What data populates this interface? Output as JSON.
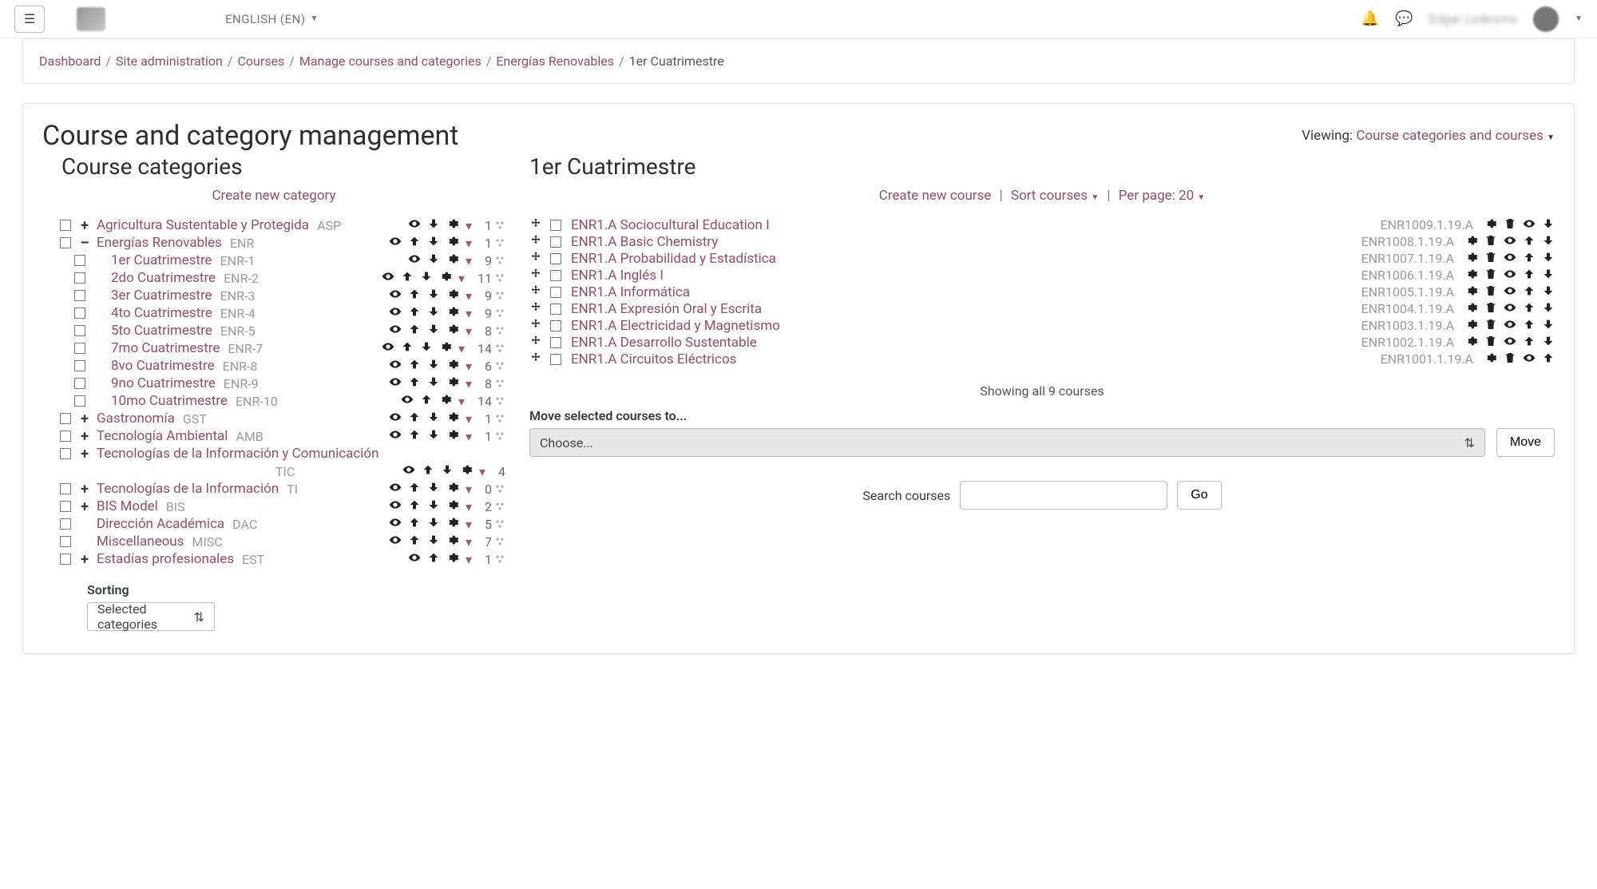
{
  "topbar": {
    "lang": "ENGLISH (EN)",
    "username": "Edgar Ledesma"
  },
  "breadcrumb": [
    "Dashboard",
    "Site administration",
    "Courses",
    "Manage courses and categories",
    "Energías Renovables",
    "1er Cuatrimestre"
  ],
  "page_title": "Course and category management",
  "viewing_label": "Viewing:",
  "viewing_value": "Course categories and courses",
  "left": {
    "title": "Course categories",
    "create": "Create new category",
    "sorting_label": "Sorting",
    "sorting_value": "Selected categories"
  },
  "categories": [
    {
      "indent": 0,
      "toggle": "+",
      "name": "Agricultura Sustentable y Protegida",
      "code": "ASP",
      "count": 1,
      "icons": [
        "eye",
        "down",
        "gear",
        "menu"
      ]
    },
    {
      "indent": 0,
      "toggle": "–",
      "name": "Energías Renovables",
      "code": "ENR",
      "count": 1,
      "icons": [
        "eye",
        "up",
        "down",
        "gear",
        "menu"
      ]
    },
    {
      "indent": 1,
      "toggle": "",
      "name": "1er Cuatrimestre",
      "code": "ENR-1",
      "count": 9,
      "icons": [
        "eye",
        "down",
        "gear",
        "menu"
      ]
    },
    {
      "indent": 1,
      "toggle": "",
      "name": "2do Cuatrimestre",
      "code": "ENR-2",
      "count": 11,
      "icons": [
        "eye",
        "up",
        "down",
        "gear",
        "menu"
      ]
    },
    {
      "indent": 1,
      "toggle": "",
      "name": "3er Cuatrimestre",
      "code": "ENR-3",
      "count": 9,
      "icons": [
        "eye",
        "up",
        "down",
        "gear",
        "menu"
      ]
    },
    {
      "indent": 1,
      "toggle": "",
      "name": "4to Cuatrimestre",
      "code": "ENR-4",
      "count": 9,
      "icons": [
        "eye",
        "up",
        "down",
        "gear",
        "menu"
      ]
    },
    {
      "indent": 1,
      "toggle": "",
      "name": "5to Cuatrimestre",
      "code": "ENR-5",
      "count": 8,
      "icons": [
        "eye",
        "up",
        "down",
        "gear",
        "menu"
      ]
    },
    {
      "indent": 1,
      "toggle": "",
      "name": "7mo Cuatrimestre",
      "code": "ENR-7",
      "count": 14,
      "icons": [
        "eye",
        "up",
        "down",
        "gear",
        "menu"
      ]
    },
    {
      "indent": 1,
      "toggle": "",
      "name": "8vo Cuatrimestre",
      "code": "ENR-8",
      "count": 6,
      "icons": [
        "eye",
        "up",
        "down",
        "gear",
        "menu"
      ]
    },
    {
      "indent": 1,
      "toggle": "",
      "name": "9no Cuatrimestre",
      "code": "ENR-9",
      "count": 8,
      "icons": [
        "eye",
        "up",
        "down",
        "gear",
        "menu"
      ]
    },
    {
      "indent": 1,
      "toggle": "",
      "name": "10mo Cuatrimestre",
      "code": "ENR-10",
      "count": 14,
      "icons": [
        "eye",
        "up",
        "gear",
        "menu"
      ]
    },
    {
      "indent": 0,
      "toggle": "+",
      "name": "Gastronomía",
      "code": "GST",
      "count": 1,
      "icons": [
        "eye",
        "up",
        "down",
        "gear",
        "menu"
      ]
    },
    {
      "indent": 0,
      "toggle": "+",
      "name": "Tecnología Ambiental",
      "code": "AMB",
      "count": 1,
      "icons": [
        "eye",
        "up",
        "down",
        "gear",
        "menu"
      ]
    },
    {
      "indent": 0,
      "toggle": "+",
      "name": "Tecnologías de la Información y Comunicación",
      "code": "TIC",
      "count": 4,
      "icons": [
        "eye",
        "up",
        "down",
        "gear",
        "menu"
      ]
    },
    {
      "indent": 0,
      "toggle": "+",
      "name": "Tecnologías de la Información",
      "code": "TI",
      "count": 0,
      "icons": [
        "eye",
        "up",
        "down",
        "gear",
        "menu"
      ]
    },
    {
      "indent": 0,
      "toggle": "+",
      "name": "BIS Model",
      "code": "BIS",
      "count": 2,
      "icons": [
        "eye",
        "up",
        "down",
        "gear",
        "menu"
      ]
    },
    {
      "indent": 0,
      "toggle": "",
      "name": "Dirección Académica",
      "code": "DAC",
      "count": 5,
      "icons": [
        "eye",
        "up",
        "down",
        "gear",
        "menu"
      ]
    },
    {
      "indent": 0,
      "toggle": "",
      "name": "Miscellaneous",
      "code": "MISC",
      "count": 7,
      "icons": [
        "eye",
        "up",
        "down",
        "gear",
        "menu"
      ]
    },
    {
      "indent": 0,
      "toggle": "+",
      "name": "Estadías profesionales",
      "code": "EST",
      "count": 1,
      "icons": [
        "eye",
        "up",
        "gear",
        "menu"
      ]
    }
  ],
  "right": {
    "title": "1er Cuatrimestre",
    "create": "Create new course",
    "sort": "Sort courses",
    "perpage": "Per page: 20",
    "showing": "Showing all 9 courses",
    "move_label": "Move selected courses to...",
    "move_select": "Choose...",
    "move_button": "Move",
    "search_label": "Search courses",
    "search_button": "Go"
  },
  "courses": [
    {
      "name": "ENR1.A Sociocultural Education I",
      "code": "ENR1009.1.19.A",
      "icons": [
        "gear",
        "trash",
        "eye",
        "down"
      ]
    },
    {
      "name": "ENR1.A Basic Chemistry",
      "code": "ENR1008.1.19.A",
      "icons": [
        "gear",
        "trash",
        "eye",
        "up",
        "down"
      ]
    },
    {
      "name": "ENR1.A Probabilidad y Estadística",
      "code": "ENR1007.1.19.A",
      "icons": [
        "gear",
        "trash",
        "eye",
        "up",
        "down"
      ]
    },
    {
      "name": "ENR1.A Inglés I",
      "code": "ENR1006.1.19.A",
      "icons": [
        "gear",
        "trash",
        "eye",
        "up",
        "down"
      ]
    },
    {
      "name": "ENR1.A Informática",
      "code": "ENR1005.1.19.A",
      "icons": [
        "gear",
        "trash",
        "eye",
        "up",
        "down"
      ]
    },
    {
      "name": "ENR1.A Expresión Oral y Escrita",
      "code": "ENR1004.1.19.A",
      "icons": [
        "gear",
        "trash",
        "eye",
        "up",
        "down"
      ]
    },
    {
      "name": "ENR1.A Electricidad y Magnetismo",
      "code": "ENR1003.1.19.A",
      "icons": [
        "gear",
        "trash",
        "eye",
        "up",
        "down"
      ]
    },
    {
      "name": "ENR1.A Desarrollo Sustentable",
      "code": "ENR1002.1.19.A",
      "icons": [
        "gear",
        "trash",
        "eye",
        "up",
        "down"
      ]
    },
    {
      "name": "ENR1.A Circuitos Eléctricos",
      "code": "ENR1001.1.19.A",
      "icons": [
        "gear",
        "trash",
        "eye",
        "up"
      ]
    }
  ]
}
